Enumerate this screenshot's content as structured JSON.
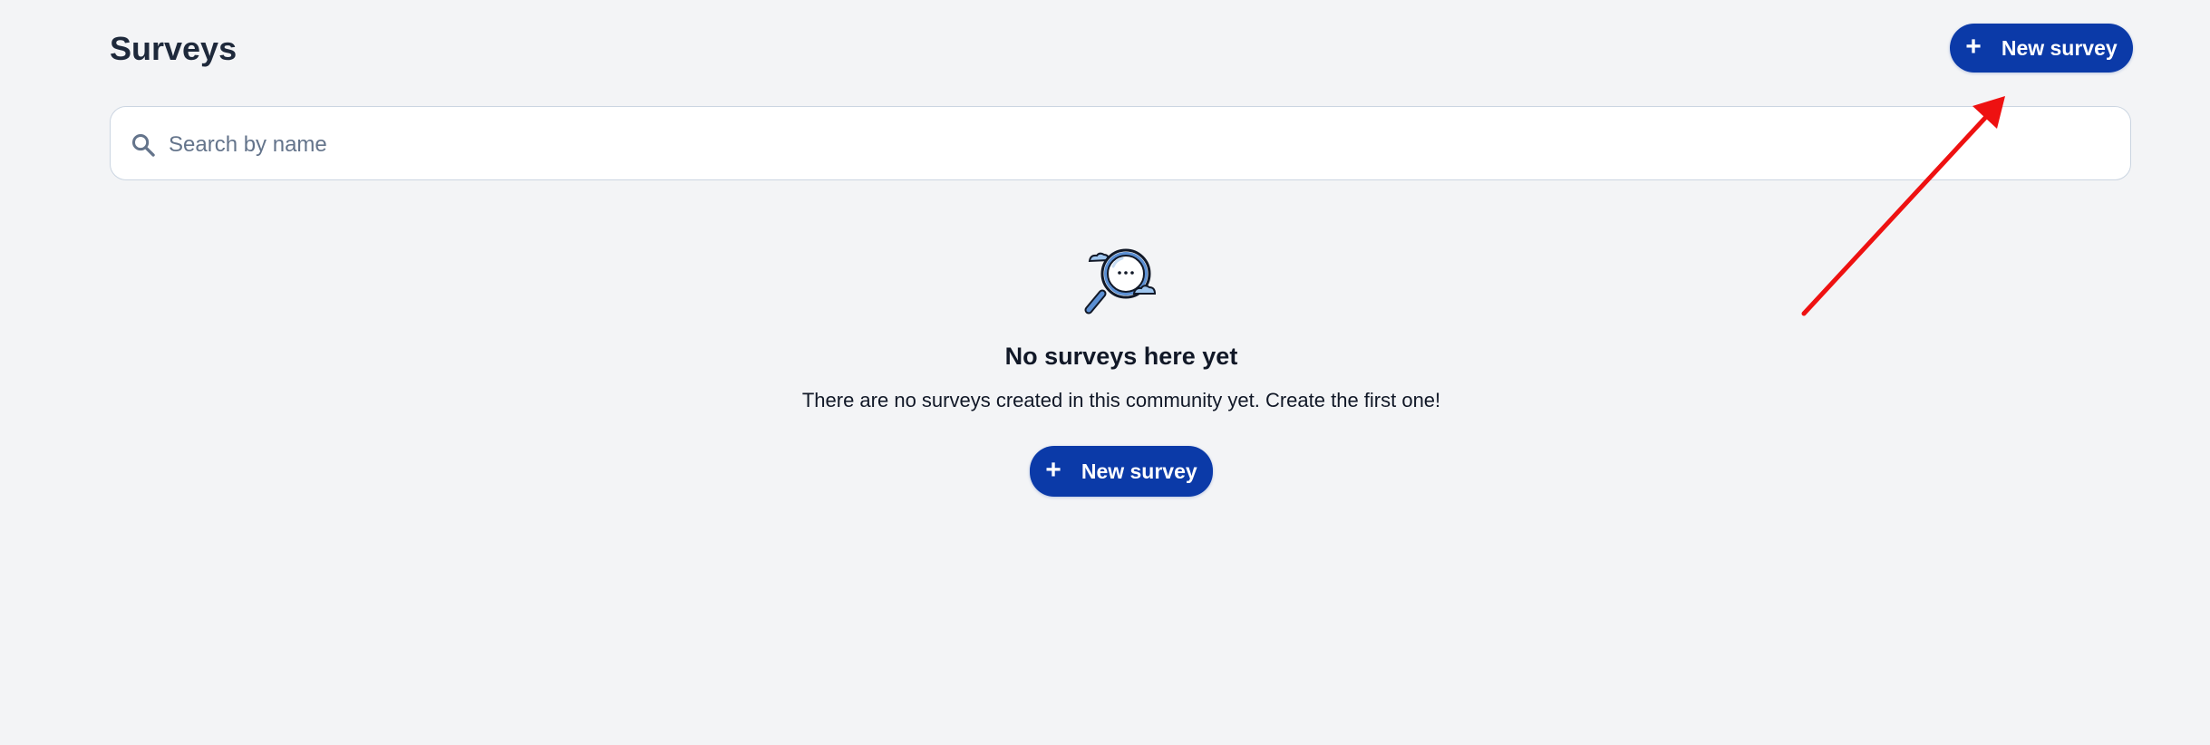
{
  "page": {
    "title": "Surveys"
  },
  "header": {
    "new_button": {
      "icon": "plus-icon",
      "label": "New survey"
    }
  },
  "search": {
    "icon": "search-icon",
    "placeholder": "Search by name",
    "value": ""
  },
  "empty_state": {
    "illustration": "magnifier-search-illustration",
    "title": "No surveys here yet",
    "description": "There are no surveys created in this community yet. Create the first one!",
    "new_button": {
      "icon": "plus-icon",
      "label": "New survey"
    }
  },
  "colors": {
    "background": "#f3f4f6",
    "primary": "#0b3aa8",
    "annotation": "#ee1111"
  }
}
